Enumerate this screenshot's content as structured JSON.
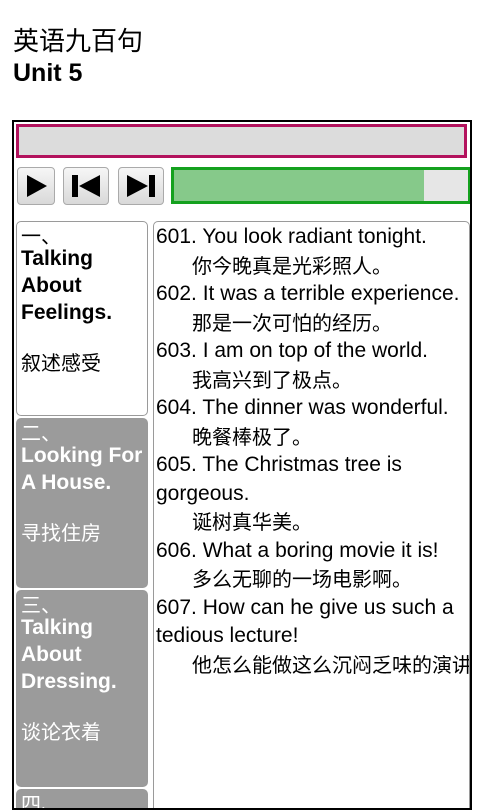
{
  "app": {
    "title": "英语九百句",
    "unit": "Unit 5"
  },
  "search": {
    "value": ""
  },
  "player": {
    "play_icon": "play-icon",
    "prev_icon": "skip-previous-icon",
    "next_icon": "skip-next-icon",
    "progress_fraction": 0.85,
    "colors": {
      "progress_border": "#14a11e",
      "progress_fill": "#86c98a",
      "search_border": "#b3125d"
    }
  },
  "sections": [
    {
      "num": "一、",
      "en": "Talking\nAbout\nFeelings.",
      "cn": "叙述感受",
      "active": true
    },
    {
      "num": "二、",
      "en": "Looking For\nA House.",
      "cn": "寻找住房",
      "active": false
    },
    {
      "num": "三、",
      "en": "Talking\nAbout\nDressing.",
      "cn": "谈论衣着",
      "active": false
    },
    {
      "num": "四、",
      "en": "",
      "cn": "",
      "active": false
    }
  ],
  "sentences": [
    {
      "en": "601. You look radiant tonight.",
      "cn": "你今晚真是光彩照人。"
    },
    {
      "en": "602. It was a terrible experience.",
      "cn": "那是一次可怕的经历。"
    },
    {
      "en": "603. I am on top of the world.",
      "cn": "我高兴到了极点。"
    },
    {
      "en": "604. The dinner was wonderful.",
      "cn": "晚餐棒极了。"
    },
    {
      "en": "605. The Christmas tree is gorgeous.",
      "cn": "诞树真华美。"
    },
    {
      "en": "606. What a boring movie it is!",
      "cn": "多么无聊的一场电影啊。"
    },
    {
      "en": "607. How can he give us such a tedious lecture!",
      "cn": "他怎么能做这么沉闷乏味的演讲。"
    }
  ]
}
